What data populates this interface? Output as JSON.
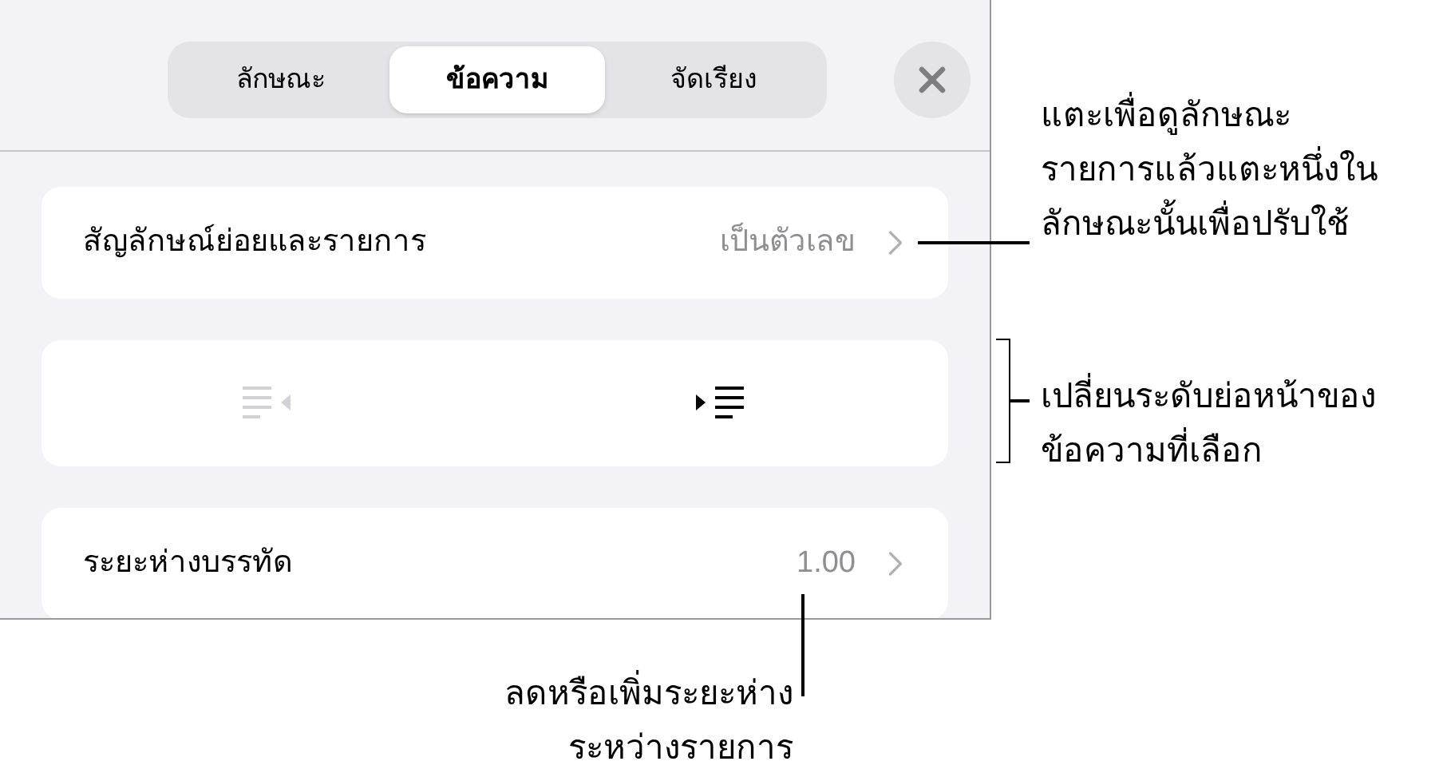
{
  "tabs": [
    {
      "label": "ลักษณะ",
      "selected": false
    },
    {
      "label": "ข้อความ",
      "selected": true
    },
    {
      "label": "จัดเรียง",
      "selected": false
    }
  ],
  "rows": [
    {
      "kind": "disclosure",
      "label": "สัญลักษณ์ย่อยและรายการ",
      "value": "เป็นตัวเลข"
    },
    {
      "kind": "indent",
      "outdent_disabled": true,
      "indent_disabled": false
    },
    {
      "kind": "disclosure",
      "label": "ระยะห่างบรรทัด",
      "value": "1.00"
    }
  ],
  "callouts": [
    {
      "text": "แตะเพื่อดูลักษณะ\nรายการแล้วแตะหนึ่งใน\nลักษณะนั้นเพื่อปรับใช้"
    },
    {
      "text": "เปลี่ยนระดับย่อหน้าของ\nข้อความที่เลือก"
    },
    {
      "text": "ลดหรือเพิ่มระยะห่าง\nระหว่างรายการ"
    }
  ]
}
